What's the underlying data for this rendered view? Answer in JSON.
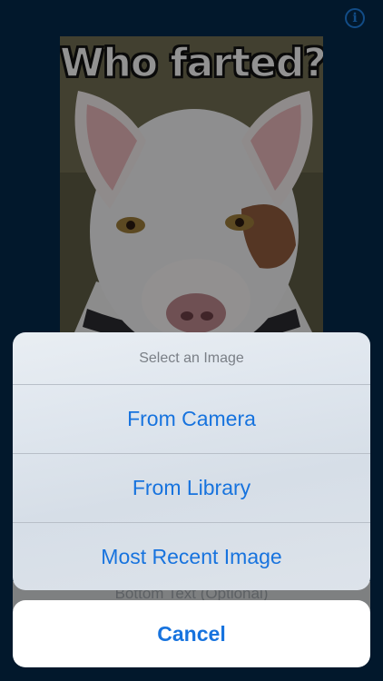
{
  "meme": {
    "top_text": "Who farted?",
    "bottom_placeholder": "Bottom Text (Optional)"
  },
  "icons": {
    "info": "info-icon",
    "info_glyph": "i"
  },
  "action_sheet": {
    "title": "Select an Image",
    "actions": [
      "From Camera",
      "From Library",
      "Most Recent Image"
    ],
    "cancel_label": "Cancel"
  },
  "colors": {
    "background": "#04284a",
    "accent": "#1773de"
  }
}
